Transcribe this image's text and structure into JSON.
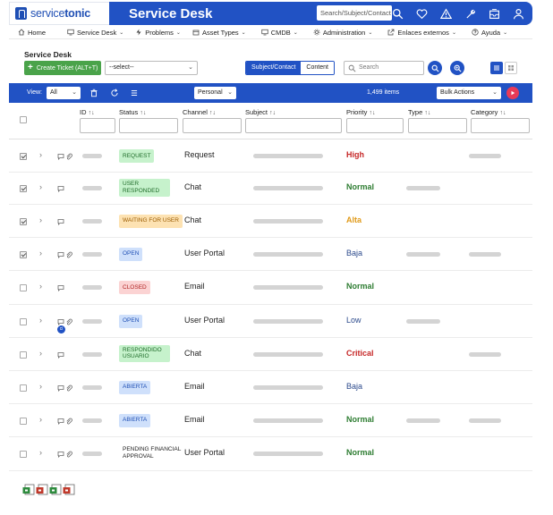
{
  "brand": {
    "name_light": "service",
    "name_bold": "tonic"
  },
  "header": {
    "title": "Service Desk",
    "search_placeholder": "Search/Subject/Contact",
    "icons": [
      "search-icon",
      "heart-icon",
      "warning-icon",
      "wrench-icon",
      "inbox-icon",
      "user-icon"
    ]
  },
  "menu": [
    {
      "label": "Home",
      "icon": "home-icon",
      "caret": false
    },
    {
      "label": "Service Desk",
      "icon": "monitor-icon",
      "caret": true
    },
    {
      "label": "Problems",
      "icon": "bolt-icon",
      "caret": true
    },
    {
      "label": "Asset Types",
      "icon": "box-icon",
      "caret": true
    },
    {
      "label": "CMDB",
      "icon": "monitor-icon",
      "caret": true
    },
    {
      "label": "Administration",
      "icon": "gear-icon",
      "caret": true
    },
    {
      "label": "Enlaces externos",
      "icon": "external-link-icon",
      "caret": true
    },
    {
      "label": "Ayuda",
      "icon": "help-icon",
      "caret": true
    }
  ],
  "page": {
    "title": "Service Desk",
    "create_button": "Create Ticket (ALT+T)",
    "select_value": "--select--",
    "toggle": {
      "subject_contact": "Subject/Contact",
      "content": "Content"
    },
    "search_placeholder": "Search"
  },
  "toolbar": {
    "view_label": "View:",
    "view_value": "All",
    "personal_value": "Personal",
    "items_count": "1,499 items",
    "bulk_actions": "Bulk Actions"
  },
  "columns": {
    "id": "ID",
    "status": "Status",
    "channel": "Channel",
    "subject": "Subject",
    "priority": "Priority",
    "type": "Type",
    "category": "Category",
    "sort_glyph": "↑↓"
  },
  "tickets": [
    {
      "checked": true,
      "attach": true,
      "ci": false,
      "status": "REQUEST",
      "status_style": "request",
      "channel": "Request",
      "priority": "High",
      "priority_style": "red",
      "has_type": false,
      "has_category": true
    },
    {
      "checked": true,
      "attach": false,
      "ci": false,
      "status_line1": "USER",
      "status_line2": "RESPONDED",
      "status_style": "responded",
      "channel": "Chat",
      "priority": "Normal",
      "priority_style": "green",
      "has_type": true,
      "has_category": false
    },
    {
      "checked": true,
      "attach": false,
      "ci": false,
      "status": "WAITING FOR USER",
      "status_style": "waiting",
      "channel": "Chat",
      "priority": "Alta",
      "priority_style": "orange",
      "has_type": false,
      "has_category": false
    },
    {
      "checked": true,
      "attach": true,
      "ci": false,
      "status": "OPEN",
      "status_style": "open",
      "channel": "User Portal",
      "priority": "Baja",
      "priority_style": "blue",
      "has_type": true,
      "has_category": true
    },
    {
      "checked": false,
      "attach": false,
      "ci": false,
      "status": "CLOSED",
      "status_style": "closed",
      "channel": "Email",
      "priority": "Normal",
      "priority_style": "green",
      "has_type": false,
      "has_category": false
    },
    {
      "checked": false,
      "attach": true,
      "ci": true,
      "ci_label": "ci",
      "status": "OPEN",
      "status_style": "open",
      "channel": "User Portal",
      "priority": "Low",
      "priority_style": "blue",
      "has_type": true,
      "has_category": false
    },
    {
      "checked": false,
      "attach": false,
      "ci": false,
      "status_line1": "RESPONDIDO",
      "status_line2": "USUARIO",
      "status_style": "responded",
      "channel": "Chat",
      "priority": "Critical",
      "priority_style": "red",
      "has_type": false,
      "has_category": true
    },
    {
      "checked": false,
      "attach": true,
      "ci": false,
      "status": "ABIERTA",
      "status_style": "open",
      "channel": "Email",
      "priority": "Baja",
      "priority_style": "blue",
      "has_type": false,
      "has_category": false
    },
    {
      "checked": false,
      "attach": true,
      "ci": false,
      "status": "ABIERTA",
      "status_style": "open",
      "channel": "Email",
      "priority": "Normal",
      "priority_style": "green",
      "has_type": true,
      "has_category": true
    },
    {
      "checked": false,
      "attach": true,
      "ci": false,
      "status_line1": "PENDING FINANCIAL",
      "status_line2": "APPROVAL",
      "status_style": "plain",
      "channel": "User Portal",
      "priority": "Normal",
      "priority_style": "green",
      "has_type": false,
      "has_category": false
    }
  ],
  "colors": {
    "brand_blue": "#2152c4",
    "create_green": "#4aa34a",
    "run_button": "#e83a57"
  },
  "export_icons": [
    "export-green-icon",
    "export-red-icon",
    "export-green-icon",
    "export-red-icon"
  ]
}
